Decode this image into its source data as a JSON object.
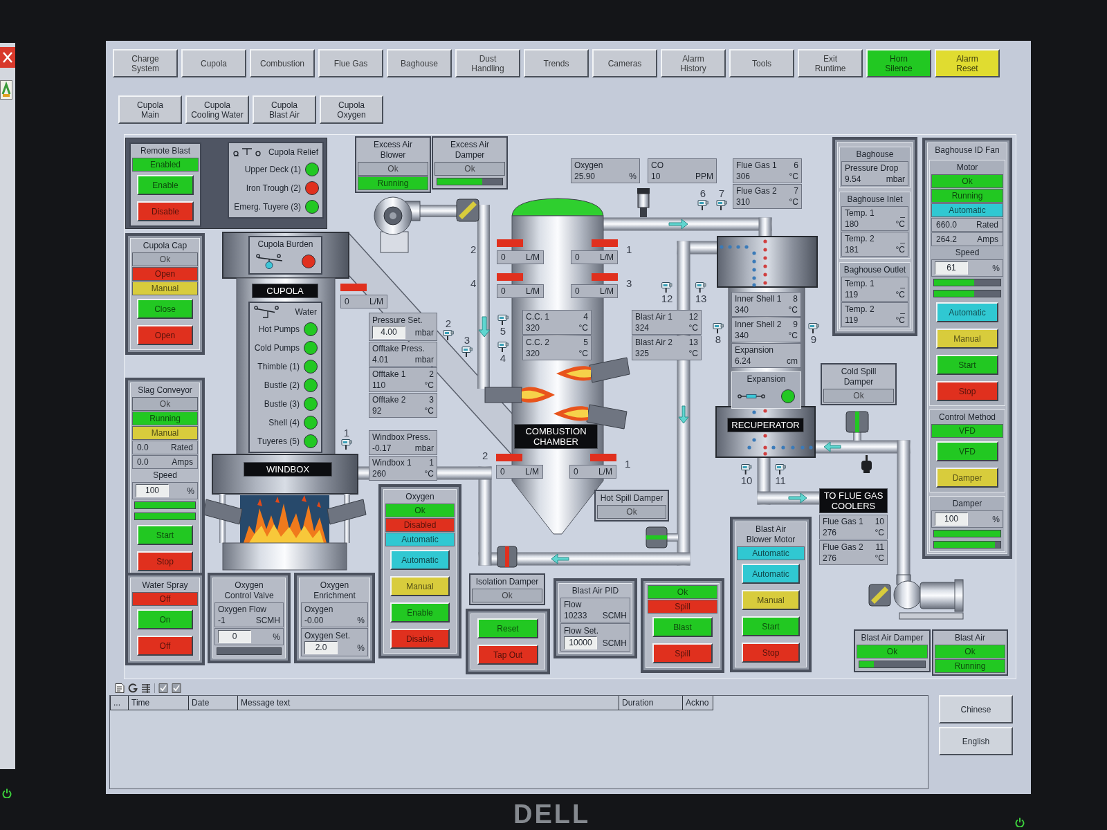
{
  "monitor": {
    "logo": "DELL"
  },
  "nav": [
    {
      "label": "Charge\nSystem",
      "color": "#c6cad2"
    },
    {
      "label": "Cupola",
      "color": "#c6cad2"
    },
    {
      "label": "Combustion",
      "color": "#c6cad2"
    },
    {
      "label": "Flue Gas",
      "color": "#c6cad2"
    },
    {
      "label": "Baghouse",
      "color": "#c6cad2"
    },
    {
      "label": "Dust\nHandling",
      "color": "#c6cad2"
    },
    {
      "label": "Trends",
      "color": "#c6cad2"
    },
    {
      "label": "Cameras",
      "color": "#c6cad2"
    },
    {
      "label": "Alarm\nHistory",
      "color": "#c6cad2"
    },
    {
      "label": "Tools",
      "color": "#c6cad2"
    },
    {
      "label": "Exit\nRuntime",
      "color": "#c6cad2"
    },
    {
      "label": "Horn\nSilence",
      "color": "#22c822"
    },
    {
      "label": "Alarm\nReset",
      "color": "#e0dc30"
    }
  ],
  "subnav": [
    {
      "label": "Cupola\nMain"
    },
    {
      "label": "Cupola\nCooling Water"
    },
    {
      "label": "Cupola\nBlast Air"
    },
    {
      "label": "Cupola\nOxygen"
    }
  ],
  "cupola_section": [
    {
      "rows": [
        {
          "kind": "title",
          "text": "Remote Blast"
        },
        {
          "kind": "status",
          "text": "Enabled",
          "color": "#22c822"
        },
        {
          "kind": "button",
          "label": "Enable",
          "color": "#22c822"
        },
        {
          "kind": "button",
          "label": "Disable",
          "color": "#e0301e"
        }
      ]
    },
    {
      "rows": [
        {
          "kind": "switch_title",
          "text": "Cupola Relief"
        },
        {
          "kind": "lamp",
          "label": "Upper Deck (1)",
          "color": "#22c822"
        },
        {
          "kind": "lamp",
          "label": "Iron Trough (2)",
          "color": "#e0301e"
        },
        {
          "kind": "lamp",
          "label": "Emerg. Tuyere (3)",
          "color": "#22c822"
        }
      ]
    },
    {
      "rows": [
        {
          "kind": "title",
          "text": "Cupola Cap"
        },
        {
          "kind": "status",
          "text": "Ok",
          "color": "#aab0bb"
        },
        {
          "kind": "status",
          "text": "Open",
          "color": "#e0301e"
        },
        {
          "kind": "status",
          "text": "Manual",
          "color": "#d8cc3c"
        },
        {
          "kind": "button",
          "label": "Close",
          "color": "#22c822"
        },
        {
          "kind": "button",
          "label": "Open",
          "color": "#e0301e"
        }
      ]
    },
    {
      "rows": [
        {
          "kind": "title",
          "text": "Cupola Burden"
        },
        {
          "kind": "switch_lamp",
          "color": "#e0301e"
        }
      ]
    },
    {
      "rows": [
        {
          "kind": "title",
          "text": "Slag Conveyor"
        },
        {
          "kind": "status",
          "text": "Ok",
          "color": "#aab0bb"
        },
        {
          "kind": "status",
          "text": "Running",
          "color": "#22c822"
        },
        {
          "kind": "status",
          "text": "Manual",
          "color": "#d8cc3c"
        },
        {
          "kind": "value",
          "value": "0.0",
          "unit": "Rated"
        },
        {
          "kind": "value",
          "value": "0.0",
          "unit": "Amps"
        },
        {
          "kind": "heading",
          "text": "Speed"
        },
        {
          "kind": "setpoint",
          "value": "100",
          "unit": "%"
        },
        {
          "kind": "bar",
          "level": 1
        },
        {
          "kind": "bar",
          "level": 1
        },
        {
          "kind": "button",
          "label": "Start",
          "color": "#22c822"
        },
        {
          "kind": "button",
          "label": "Stop",
          "color": "#e0301e"
        }
      ]
    },
    {
      "rows": [
        {
          "kind": "switch_title",
          "text": "Water"
        },
        {
          "kind": "lamp",
          "label": "Hot Pumps",
          "color": "#22c822"
        },
        {
          "kind": "lamp",
          "label": "Cold Pumps",
          "color": "#22c822"
        },
        {
          "kind": "lamp",
          "label": "Thimble (1)",
          "color": "#22c822"
        },
        {
          "kind": "lamp",
          "label": "Bustle (2)",
          "color": "#22c822"
        },
        {
          "kind": "lamp",
          "label": "Bustle (3)",
          "color": "#22c822"
        },
        {
          "kind": "lamp",
          "label": "Shell (4)",
          "color": "#22c822"
        },
        {
          "kind": "lamp",
          "label": "Tuyeres (5)",
          "color": "#22c822"
        }
      ]
    },
    {
      "rows": [
        {
          "kind": "title",
          "text": "Water Spray"
        },
        {
          "kind": "status",
          "text": "Off",
          "color": "#e0301e"
        },
        {
          "kind": "button",
          "label": "On",
          "color": "#22c822"
        },
        {
          "kind": "button",
          "label": "Off",
          "color": "#e0301e"
        }
      ]
    },
    {
      "rows": [
        {
          "kind": "title",
          "text": "Oxygen\nControl Valve"
        },
        {
          "kind": "reading",
          "label": "Oxygen Flow",
          "value": "-1",
          "unit": "SCMH"
        },
        {
          "kind": "setpoint",
          "value": "0",
          "unit": "%"
        },
        {
          "kind": "bar",
          "level": 0
        }
      ]
    },
    {
      "rows": [
        {
          "kind": "title",
          "text": "Oxygen\nEnrichment"
        },
        {
          "kind": "reading",
          "label": "Oxygen",
          "value": "-0.00",
          "unit": "%"
        },
        {
          "kind": "setpoint",
          "label": "Oxygen Set.",
          "value": "2.0",
          "unit": "%"
        }
      ]
    }
  ],
  "combustion_section": [
    {
      "rows": [
        {
          "kind": "title",
          "text": "Excess Air\nBlower"
        },
        {
          "kind": "status",
          "text": "Ok",
          "color": "#aab0bb"
        },
        {
          "kind": "status",
          "text": "Running",
          "color": "#22c822"
        }
      ]
    },
    {
      "rows": [
        {
          "kind": "title",
          "text": "Excess Air\nDamper"
        },
        {
          "kind": "status",
          "text": "Ok",
          "color": "#aab0bb"
        },
        {
          "kind": "bar",
          "level": 0.69
        }
      ]
    },
    {
      "rows": [
        {
          "kind": "reading",
          "label": "Oxygen",
          "value": "25.90",
          "unit": "%"
        }
      ]
    },
    {
      "rows": [
        {
          "kind": "reading",
          "label": "CO",
          "value": "10",
          "unit": "PPM"
        }
      ]
    },
    {
      "rows": [
        {
          "kind": "setpoint",
          "label": "Pressure Set.",
          "value": "4.00",
          "unit": "mbar"
        },
        {
          "kind": "reading",
          "label": "Offtake Press.",
          "value": "4.01",
          "unit": "mbar"
        },
        {
          "kind": "reading",
          "label": "Offtake 1",
          "tag": "2",
          "value": "110",
          "unit": "°C"
        },
        {
          "kind": "reading",
          "label": "Offtake 2",
          "tag": "3",
          "value": "92",
          "unit": "°C"
        }
      ]
    },
    {
      "rows": [
        {
          "kind": "reading",
          "label": "C.C. 1",
          "tag": "4",
          "value": "320",
          "unit": "°C"
        },
        {
          "kind": "reading",
          "label": "C.C. 2",
          "tag": "5",
          "value": "320",
          "unit": "°C"
        }
      ]
    },
    {
      "rows": [
        {
          "kind": "reading",
          "label": "Blast Air 1",
          "tag": "12",
          "value": "324",
          "unit": "°C"
        },
        {
          "kind": "reading",
          "label": "Blast Air 2",
          "tag": "13",
          "value": "325",
          "unit": "°C"
        }
      ]
    },
    {
      "rows": [
        {
          "kind": "reading",
          "label": "Windbox Press.",
          "value": "-0.17",
          "unit": "mbar"
        },
        {
          "kind": "reading",
          "label": "Windbox 1",
          "tag": "1",
          "value": "260",
          "unit": "°C"
        }
      ]
    },
    {
      "rows": [
        {
          "kind": "title",
          "text": "Oxygen"
        },
        {
          "kind": "status",
          "text": "Ok",
          "color": "#22c822"
        },
        {
          "kind": "status",
          "text": "Disabled",
          "color": "#e0301e"
        },
        {
          "kind": "status",
          "text": "Automatic",
          "color": "#30c8d2"
        },
        {
          "kind": "button",
          "label": "Automatic",
          "color": "#30c8d2"
        },
        {
          "kind": "button",
          "label": "Manual",
          "color": "#d8cc3c"
        },
        {
          "kind": "button",
          "label": "Enable",
          "color": "#22c822"
        },
        {
          "kind": "button",
          "label": "Disable",
          "color": "#e0301e"
        }
      ]
    },
    {
      "rows": [
        {
          "kind": "title",
          "text": "Hot Spill Damper"
        },
        {
          "kind": "status",
          "text": "Ok",
          "color": "#aab0bb"
        }
      ]
    },
    {
      "rows": [
        {
          "kind": "title",
          "text": "Isolation Damper"
        },
        {
          "kind": "status",
          "text": "Ok",
          "color": "#aab0bb"
        }
      ]
    },
    {
      "rows": [
        {
          "kind": "button",
          "label": "Reset",
          "color": "#22c822"
        },
        {
          "kind": "button",
          "label": "Tap Out",
          "color": "#e0301e"
        }
      ]
    },
    {
      "rows": [
        {
          "kind": "title",
          "text": "Blast Air PID"
        },
        {
          "kind": "reading",
          "label": "Flow",
          "value": "10233",
          "unit": "SCMH"
        },
        {
          "kind": "setpoint",
          "label": "Flow Set.",
          "value": "10000",
          "unit": "SCMH"
        }
      ]
    },
    {
      "rows": [
        {
          "kind": "status",
          "text": "Ok",
          "color": "#22c822"
        },
        {
          "kind": "status",
          "text": "Spill",
          "color": "#e0301e"
        },
        {
          "kind": "button",
          "label": "Blast",
          "color": "#22c822"
        },
        {
          "kind": "button",
          "label": "Spill",
          "color": "#e0301e"
        }
      ]
    }
  ],
  "recuperator_section": [
    {
      "rows": [
        {
          "kind": "reading",
          "label": "Flue Gas 1",
          "tag": "6",
          "value": "306",
          "unit": "°C"
        },
        {
          "kind": "reading",
          "label": "Flue Gas 2",
          "tag": "7",
          "value": "310",
          "unit": "°C"
        }
      ]
    },
    {
      "rows": [
        {
          "kind": "reading",
          "label": "Inner Shell 1",
          "tag": "8",
          "value": "340",
          "unit": "°C"
        },
        {
          "kind": "reading",
          "label": "Inner Shell 2",
          "tag": "9",
          "value": "340",
          "unit": "°C"
        },
        {
          "kind": "reading",
          "label": "Expansion",
          "value": "6.24",
          "unit": "cm"
        },
        {
          "kind": "group",
          "title": "Expansion",
          "rows": [
            {
              "kind": "switch_lamp",
              "color": "#22c822"
            }
          ]
        }
      ]
    },
    {
      "rows": [
        {
          "kind": "group",
          "title": "Baghouse",
          "rows": [
            {
              "kind": "reading",
              "label": "Pressure Drop",
              "value": "9.54",
              "unit": "mbar"
            }
          ]
        },
        {
          "kind": "group",
          "title": "Baghouse Inlet",
          "rows": [
            {
              "kind": "reading",
              "label": "Temp. 1",
              "tag": "_",
              "value": "180",
              "unit": "°C"
            },
            {
              "kind": "reading",
              "label": "Temp. 2",
              "tag": "_",
              "value": "181",
              "unit": "°C"
            }
          ]
        },
        {
          "kind": "group",
          "title": "Baghouse Outlet",
          "rows": [
            {
              "kind": "reading",
              "label": "Temp. 1",
              "tag": "_",
              "value": "119",
              "unit": "°C"
            },
            {
              "kind": "reading",
              "label": "Temp. 2",
              "tag": "_",
              "value": "119",
              "unit": "°C"
            }
          ]
        }
      ]
    },
    {
      "rows": [
        {
          "kind": "title",
          "text": "Cold Spill\nDamper"
        },
        {
          "kind": "status",
          "text": "Ok",
          "color": "#aab0bb"
        }
      ]
    },
    {
      "rows": [
        {
          "kind": "title",
          "text": "Blast Air\nBlower Motor"
        },
        {
          "kind": "status",
          "text": "Automatic",
          "color": "#30c8d2"
        },
        {
          "kind": "button",
          "label": "Automatic",
          "color": "#30c8d2"
        },
        {
          "kind": "button",
          "label": "Manual",
          "color": "#d8cc3c"
        },
        {
          "kind": "button",
          "label": "Start",
          "color": "#22c822"
        },
        {
          "kind": "button",
          "label": "Stop",
          "color": "#e0301e"
        }
      ]
    },
    {
      "rows": [
        {
          "kind": "reading",
          "label": "Flue Gas 1",
          "tag": "10",
          "value": "276",
          "unit": "°C"
        },
        {
          "kind": "reading",
          "label": "Flue Gas 2",
          "tag": "11",
          "value": "276",
          "unit": "°C"
        }
      ]
    },
    {
      "rows": [
        {
          "kind": "title",
          "text": "Baghouse ID Fan"
        },
        {
          "kind": "group",
          "title": "Motor",
          "rows": [
            {
              "kind": "status",
              "text": "Ok",
              "color": "#22c822"
            },
            {
              "kind": "status",
              "text": "Running",
              "color": "#22c822"
            },
            {
              "kind": "status",
              "text": "Automatic",
              "color": "#30c8d2"
            },
            {
              "kind": "value",
              "value": "660.0",
              "unit": "Rated"
            },
            {
              "kind": "value",
              "value": "264.2",
              "unit": "Amps"
            },
            {
              "kind": "heading",
              "text": "Speed"
            },
            {
              "kind": "setpoint",
              "value": "61",
              "unit": "%"
            },
            {
              "kind": "bar",
              "level": 0.6
            },
            {
              "kind": "bar",
              "level": 0.6
            },
            {
              "kind": "button",
              "label": "Automatic",
              "color": "#30c8d2"
            },
            {
              "kind": "button",
              "label": "Manual",
              "color": "#d8cc3c"
            },
            {
              "kind": "button",
              "label": "Start",
              "color": "#22c822"
            },
            {
              "kind": "button",
              "label": "Stop",
              "color": "#e0301e"
            }
          ]
        },
        {
          "kind": "group",
          "title": "Control Method",
          "rows": [
            {
              "kind": "status",
              "text": "VFD",
              "color": "#22c822"
            },
            {
              "kind": "button",
              "label": "VFD",
              "color": "#22c822"
            },
            {
              "kind": "button",
              "label": "Damper",
              "color": "#d8cc3c"
            }
          ]
        },
        {
          "kind": "group",
          "title": "Damper",
          "rows": [
            {
              "kind": "setpoint",
              "value": "100",
              "unit": "%"
            },
            {
              "kind": "bar",
              "level": 1
            },
            {
              "kind": "bar",
              "level": 0.92
            }
          ]
        }
      ]
    },
    {
      "rows": [
        {
          "kind": "title",
          "text": "Blast Air Damper"
        },
        {
          "kind": "status",
          "text": "Ok",
          "color": "#22c822"
        },
        {
          "kind": "bar",
          "level": 0.22
        }
      ]
    },
    {
      "rows": [
        {
          "kind": "title",
          "text": "Blast Air"
        },
        {
          "kind": "status",
          "text": "Ok",
          "color": "#22c822"
        },
        {
          "kind": "status",
          "text": "Running",
          "color": "#22c822"
        }
      ]
    }
  ],
  "labels": [
    "CUPOLA",
    "COMBUSTION\nCHAMBER",
    "RECUPERATOR",
    "WINDBOX",
    "TO FLUE GAS\nCOOLERS"
  ],
  "flowmeters": [
    {
      "value": "0",
      "unit": "L/M",
      "color": "#e0301e"
    },
    {
      "value": "0",
      "unit": "L/M",
      "color": "#e0301e"
    },
    {
      "value": "0",
      "unit": "L/M",
      "color": "#e0301e"
    },
    {
      "value": "0",
      "unit": "L/M",
      "color": "#e0301e"
    },
    {
      "value": "0",
      "unit": "L/M",
      "color": "#e0301e"
    },
    {
      "value": "0",
      "unit": "L/M",
      "color": "#e0301e"
    },
    {
      "value": "0",
      "unit": "L/M",
      "color": "#e0301e"
    }
  ],
  "flow_labels": [
    "2",
    "1",
    "4",
    "3",
    "2",
    "1"
  ],
  "sensors": [
    {
      "label": "6"
    },
    {
      "label": "7"
    },
    {
      "label": "12"
    },
    {
      "label": "13"
    },
    {
      "label": "2"
    },
    {
      "label": "3"
    },
    {
      "label": "5"
    },
    {
      "label": "4"
    },
    {
      "label": "8"
    },
    {
      "label": "9"
    },
    {
      "label": "1"
    },
    {
      "label": "10"
    },
    {
      "label": "11"
    }
  ],
  "valves": [
    {
      "color": "#d8cc3c"
    },
    {
      "color": "#22c822"
    },
    {
      "color": "#e0301e"
    },
    {
      "color": "#22c822"
    },
    {
      "color": "#d8cc3c"
    }
  ],
  "alarm_log": {
    "columns": [
      "...",
      "Time",
      "Date",
      "Message text",
      "Duration",
      "Ackno"
    ]
  },
  "language_buttons": [
    {
      "label": "Chinese"
    },
    {
      "label": "English"
    }
  ]
}
